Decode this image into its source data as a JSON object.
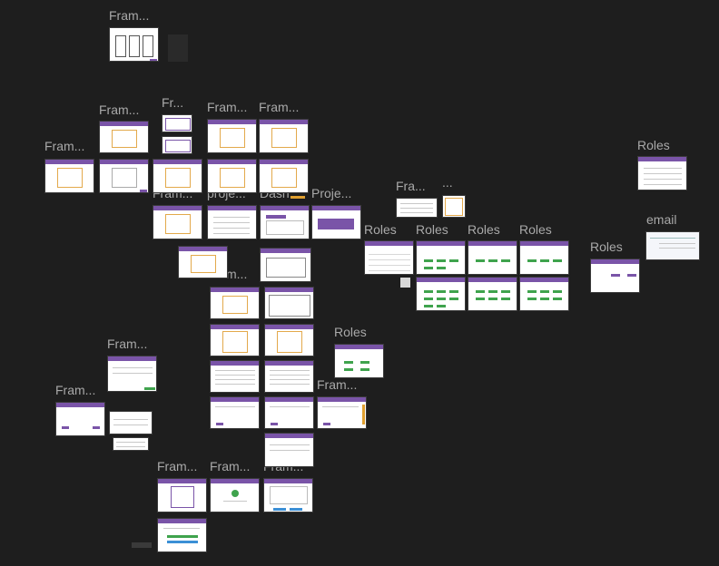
{
  "app": {
    "name": "design canvas",
    "background": "#1e1e1e",
    "accent": "#7a54a8",
    "label_color": "#a9a9a9"
  },
  "labels": {
    "fram_a": "Fram...",
    "fram_b": "Fram...",
    "fr_c": "Fr...",
    "fram_d": "Fram...",
    "fram_e": "Fram...",
    "fram_f": "Fram...",
    "fram_g": "Fram...",
    "proje_h": "proje...",
    "dash_i": "Dash...",
    "proje_j": "Proje...",
    "fra_k": "Fra...",
    "dots_l": "...",
    "roles_1": "Roles",
    "roles_2": "Roles",
    "roles_3": "Roles",
    "roles_4": "Roles",
    "roles_5": "Roles",
    "roles_6": "Roles",
    "roles_7": "Roles",
    "email": "email",
    "fram_m": "Fram...",
    "fram_n": "Fram...",
    "fram_o": "Fram...",
    "fram_p": "Fram...",
    "fram_q": "Fram...",
    "fram_r": "Fram...",
    "fram_s": "Fram...",
    "fram_t": "Fram..."
  }
}
